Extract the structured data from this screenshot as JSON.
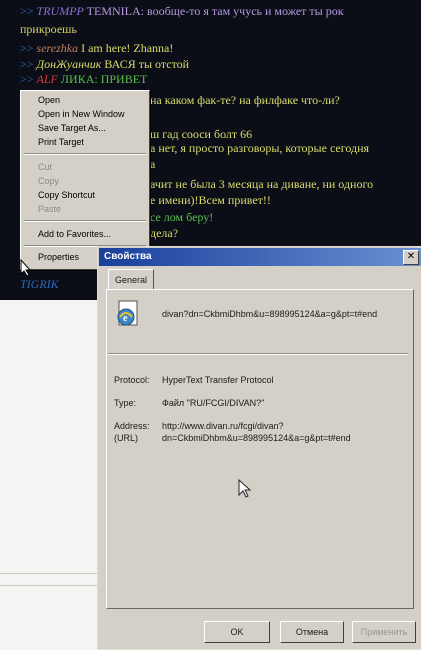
{
  "chat": {
    "lines": [
      {
        "gt": ">>",
        "nick": "TRUMPP",
        "text": "TEMNILA: вообще-то я там учусь и может ты рок",
        "nick_color": "#8a6fd0",
        "text_color": "#b898e0"
      },
      {
        "gt": "",
        "nick": "",
        "text": "прикроешь",
        "nick_color": "#ccc",
        "text_color": "#d8d060"
      },
      {
        "gt": ">>",
        "nick": "serezhka",
        "text": "I am here! Zhanna!",
        "nick_color": "#c08060",
        "text_color": "#d9dc6c"
      },
      {
        "gt": ">>",
        "nick": "ДонЖуанчик",
        "text": "ВАСЯ ты отстой",
        "nick_color": "#d9dc6c",
        "text_color": "#d9dc6c"
      },
      {
        "gt": ">>",
        "nick": "ALF",
        "text": "ЛИКА: ПРИВЕТ",
        "nick_color": "#e03838",
        "text_color": "#58c04c"
      },
      {
        "gt": "",
        "nick": "",
        "text": "на каком фак-те? на филфаке что-ли?",
        "nick_color": "#ccc",
        "text_color": "#d9dc6c"
      },
      {
        "gt": "",
        "nick": "",
        "text": "ш гад сооси болт 66",
        "nick_color": "#ccc",
        "text_color": "#d9dc6c"
      },
      {
        "gt": "",
        "nick": "",
        "text": "а нет, я просто разговоры, которые сегодня",
        "nick_color": "#ccc",
        "text_color": "#d9dc6c"
      },
      {
        "gt": "",
        "nick": "",
        "text": "а",
        "nick_color": "#ccc",
        "text_color": "#d9dc6c"
      },
      {
        "gt": "",
        "nick": "",
        "text": "ачит не была 3 месяца на диване, ни одного",
        "nick_color": "#ccc",
        "text_color": "#d9dc6c"
      },
      {
        "gt": "",
        "nick": "",
        "text": "е имени)!Всем привет!!",
        "nick_color": "#ccc",
        "text_color": "#d9dc6c"
      },
      {
        "gt": "",
        "nick": "",
        "text": "се лом беру!",
        "nick_color": "#ccc",
        "text_color": "#58c04c"
      },
      {
        "gt": "",
        "nick": "",
        "text": "дела?",
        "nick_color": "#ccc",
        "text_color": "#d9dc6c"
      },
      {
        "gt": "",
        "nick": "TIGRIK",
        "text": "",
        "nick_color": "#2a6cc0",
        "text_color": "#d9dc6c"
      }
    ]
  },
  "context_menu": {
    "items": [
      {
        "label": "Open",
        "enabled": true
      },
      {
        "label": "Open in New Window",
        "enabled": true
      },
      {
        "label": "Save Target As...",
        "enabled": true
      },
      {
        "label": "Print Target",
        "enabled": true
      },
      {
        "label": "Cut",
        "enabled": false
      },
      {
        "label": "Copy",
        "enabled": false
      },
      {
        "label": "Copy Shortcut",
        "enabled": true
      },
      {
        "label": "Paste",
        "enabled": false
      },
      {
        "label": "Add to Favorites...",
        "enabled": true
      },
      {
        "label": "Properties",
        "enabled": true
      }
    ]
  },
  "dialog": {
    "title": "Свойства",
    "close_glyph": "✕",
    "tab_label": "General",
    "filename": "divan?dn=CkbmiDhbm&u=898995124&a=g&pt=t#end",
    "protocol_label": "Protocol:",
    "protocol_value": "HyperText Transfer Protocol",
    "type_label": "Type:",
    "type_value": "Файл \"RU/FCGI/DIVAN?\"",
    "address_label": "Address:",
    "address_label2": "(URL)",
    "address_value_1": "http://www.divan.ru/fcgi/divan?",
    "address_value_2": "dn=CkbmiDhbm&u=898995124&a=g&pt=t#end",
    "ok_label": "OK",
    "cancel_label": "Отмена",
    "apply_label": "Применить"
  },
  "colors": {
    "chat_background": "#0c0e17",
    "dialog_face": "#d4d0c8",
    "titlebar_start": "#1a3f9c",
    "titlebar_end": "#6b8fd1"
  }
}
